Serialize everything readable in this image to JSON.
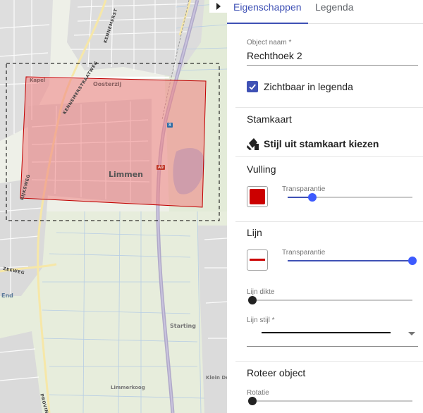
{
  "map": {
    "labels": {
      "limmen": "Limmen",
      "oosterzij": "Oosterzij",
      "kapel": "Kapel",
      "starting": "Starting",
      "limmerkoog": "Limmerkoog",
      "klein_do": "Klein Do",
      "end": "End",
      "zeeweg": "ZEEWEG",
      "rijksweg": "RIJKSWEG",
      "kennemerstraatweg": "KENNEMERSTRAATWEG",
      "kennemerstr_top": "KENNEMERST",
      "provinciale": "PROVINCIALE",
      "a9_shield": "A9",
      "exit_shield": "8"
    },
    "colors": {
      "selection_fill": "#f08080",
      "selection_stroke": "#c00000",
      "motorway": "#b0a9c8",
      "water": "#a6c2e0",
      "built": "#d9d9d9",
      "green": "#d6e4c8"
    }
  },
  "panel": {
    "toggle_icon": "caret-right-icon",
    "tabs": {
      "properties": "Eigenschappen",
      "legend": "Legenda"
    },
    "object_name": {
      "label": "Object naam *",
      "value": "Rechthoek 2"
    },
    "visible_in_legend": {
      "label": "Zichtbaar in legenda",
      "checked": true
    },
    "stamkaart": {
      "title": "Stamkaart",
      "button_label": "Stijl uit stamkaart kiezen",
      "icon": "stamp-style-icon"
    },
    "fill": {
      "title": "Vulling",
      "color": "#cc0000",
      "transparency_label": "Transparantie",
      "transparency": 0.2
    },
    "line": {
      "title": "Lijn",
      "color": "#cc0000",
      "transparency_label": "Transparantie",
      "transparency": 1.0,
      "width_label": "Lijn dikte",
      "width": 0,
      "style_label": "Lijn stijl *",
      "style_value": "solid"
    },
    "rotate": {
      "title": "Roteer object",
      "rotation_label": "Rotatie",
      "rotation": 0
    },
    "accent": "#3f51b5",
    "slider_thumb": "#3d5afe"
  }
}
